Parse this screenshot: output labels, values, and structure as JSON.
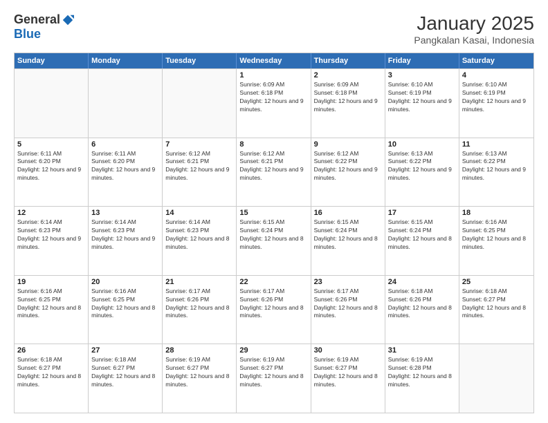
{
  "logo": {
    "general": "General",
    "blue": "Blue"
  },
  "title": "January 2025",
  "location": "Pangkalan Kasai, Indonesia",
  "header_days": [
    "Sunday",
    "Monday",
    "Tuesday",
    "Wednesday",
    "Thursday",
    "Friday",
    "Saturday"
  ],
  "weeks": [
    [
      {
        "day": "",
        "info": ""
      },
      {
        "day": "",
        "info": ""
      },
      {
        "day": "",
        "info": ""
      },
      {
        "day": "1",
        "info": "Sunrise: 6:09 AM\nSunset: 6:18 PM\nDaylight: 12 hours and 9 minutes."
      },
      {
        "day": "2",
        "info": "Sunrise: 6:09 AM\nSunset: 6:18 PM\nDaylight: 12 hours and 9 minutes."
      },
      {
        "day": "3",
        "info": "Sunrise: 6:10 AM\nSunset: 6:19 PM\nDaylight: 12 hours and 9 minutes."
      },
      {
        "day": "4",
        "info": "Sunrise: 6:10 AM\nSunset: 6:19 PM\nDaylight: 12 hours and 9 minutes."
      }
    ],
    [
      {
        "day": "5",
        "info": "Sunrise: 6:11 AM\nSunset: 6:20 PM\nDaylight: 12 hours and 9 minutes."
      },
      {
        "day": "6",
        "info": "Sunrise: 6:11 AM\nSunset: 6:20 PM\nDaylight: 12 hours and 9 minutes."
      },
      {
        "day": "7",
        "info": "Sunrise: 6:12 AM\nSunset: 6:21 PM\nDaylight: 12 hours and 9 minutes."
      },
      {
        "day": "8",
        "info": "Sunrise: 6:12 AM\nSunset: 6:21 PM\nDaylight: 12 hours and 9 minutes."
      },
      {
        "day": "9",
        "info": "Sunrise: 6:12 AM\nSunset: 6:22 PM\nDaylight: 12 hours and 9 minutes."
      },
      {
        "day": "10",
        "info": "Sunrise: 6:13 AM\nSunset: 6:22 PM\nDaylight: 12 hours and 9 minutes."
      },
      {
        "day": "11",
        "info": "Sunrise: 6:13 AM\nSunset: 6:22 PM\nDaylight: 12 hours and 9 minutes."
      }
    ],
    [
      {
        "day": "12",
        "info": "Sunrise: 6:14 AM\nSunset: 6:23 PM\nDaylight: 12 hours and 9 minutes."
      },
      {
        "day": "13",
        "info": "Sunrise: 6:14 AM\nSunset: 6:23 PM\nDaylight: 12 hours and 9 minutes."
      },
      {
        "day": "14",
        "info": "Sunrise: 6:14 AM\nSunset: 6:23 PM\nDaylight: 12 hours and 8 minutes."
      },
      {
        "day": "15",
        "info": "Sunrise: 6:15 AM\nSunset: 6:24 PM\nDaylight: 12 hours and 8 minutes."
      },
      {
        "day": "16",
        "info": "Sunrise: 6:15 AM\nSunset: 6:24 PM\nDaylight: 12 hours and 8 minutes."
      },
      {
        "day": "17",
        "info": "Sunrise: 6:15 AM\nSunset: 6:24 PM\nDaylight: 12 hours and 8 minutes."
      },
      {
        "day": "18",
        "info": "Sunrise: 6:16 AM\nSunset: 6:25 PM\nDaylight: 12 hours and 8 minutes."
      }
    ],
    [
      {
        "day": "19",
        "info": "Sunrise: 6:16 AM\nSunset: 6:25 PM\nDaylight: 12 hours and 8 minutes."
      },
      {
        "day": "20",
        "info": "Sunrise: 6:16 AM\nSunset: 6:25 PM\nDaylight: 12 hours and 8 minutes."
      },
      {
        "day": "21",
        "info": "Sunrise: 6:17 AM\nSunset: 6:26 PM\nDaylight: 12 hours and 8 minutes."
      },
      {
        "day": "22",
        "info": "Sunrise: 6:17 AM\nSunset: 6:26 PM\nDaylight: 12 hours and 8 minutes."
      },
      {
        "day": "23",
        "info": "Sunrise: 6:17 AM\nSunset: 6:26 PM\nDaylight: 12 hours and 8 minutes."
      },
      {
        "day": "24",
        "info": "Sunrise: 6:18 AM\nSunset: 6:26 PM\nDaylight: 12 hours and 8 minutes."
      },
      {
        "day": "25",
        "info": "Sunrise: 6:18 AM\nSunset: 6:27 PM\nDaylight: 12 hours and 8 minutes."
      }
    ],
    [
      {
        "day": "26",
        "info": "Sunrise: 6:18 AM\nSunset: 6:27 PM\nDaylight: 12 hours and 8 minutes."
      },
      {
        "day": "27",
        "info": "Sunrise: 6:18 AM\nSunset: 6:27 PM\nDaylight: 12 hours and 8 minutes."
      },
      {
        "day": "28",
        "info": "Sunrise: 6:19 AM\nSunset: 6:27 PM\nDaylight: 12 hours and 8 minutes."
      },
      {
        "day": "29",
        "info": "Sunrise: 6:19 AM\nSunset: 6:27 PM\nDaylight: 12 hours and 8 minutes."
      },
      {
        "day": "30",
        "info": "Sunrise: 6:19 AM\nSunset: 6:27 PM\nDaylight: 12 hours and 8 minutes."
      },
      {
        "day": "31",
        "info": "Sunrise: 6:19 AM\nSunset: 6:28 PM\nDaylight: 12 hours and 8 minutes."
      },
      {
        "day": "",
        "info": ""
      }
    ]
  ]
}
